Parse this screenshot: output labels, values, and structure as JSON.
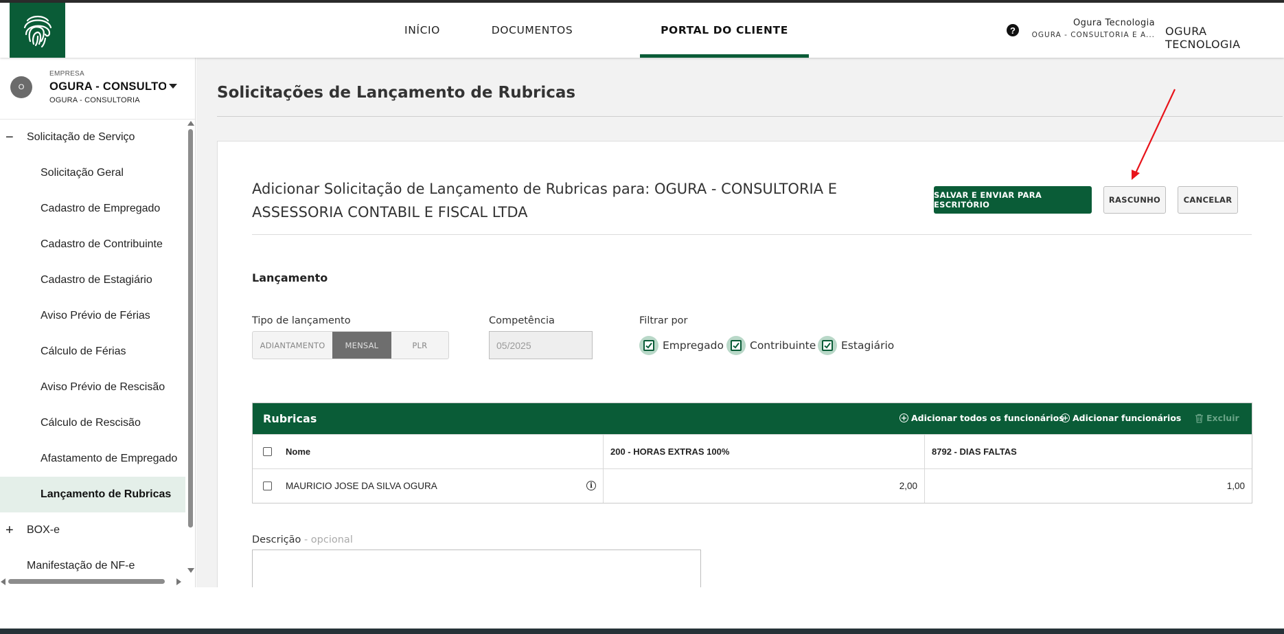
{
  "header": {
    "nav": [
      {
        "label": "INÍCIO",
        "active": false
      },
      {
        "label": "DOCUMENTOS",
        "active": false
      },
      {
        "label": "PORTAL DO CLIENTE",
        "active": true
      }
    ],
    "help_icon": "?",
    "user_name": "Ogura Tecnologia",
    "user_company": "OGURA - CONSULTORIA E A...",
    "org_name": "OGURA TECNOLOGIA",
    "brand_color": "#0a5c37"
  },
  "sidebar": {
    "company_avatar": "O",
    "company_label": "EMPRESA",
    "company_name": "OGURA - CONSULTORIA E ASSESSORIA",
    "company_sub": "OGURA - CONSULTORIA",
    "items": [
      {
        "label": "Solicitação de Serviço",
        "type": "group",
        "sign": "−"
      },
      {
        "label": "Solicitação Geral",
        "type": "sub"
      },
      {
        "label": "Cadastro de Empregado",
        "type": "sub"
      },
      {
        "label": "Cadastro de Contribuinte",
        "type": "sub"
      },
      {
        "label": "Cadastro de Estagiário",
        "type": "sub"
      },
      {
        "label": "Aviso Prévio de Férias",
        "type": "sub"
      },
      {
        "label": "Cálculo de Férias",
        "type": "sub"
      },
      {
        "label": "Aviso Prévio de Rescisão",
        "type": "sub"
      },
      {
        "label": "Cálculo de Rescisão",
        "type": "sub"
      },
      {
        "label": "Afastamento de Empregado",
        "type": "sub"
      },
      {
        "label": "Lançamento de Rubricas",
        "type": "sub",
        "active": true
      },
      {
        "label": "BOX-e",
        "type": "group",
        "sign": "+"
      },
      {
        "label": "Manifestação de NF-e",
        "type": "group"
      }
    ]
  },
  "main": {
    "page_title": "Solicitações de Lançamento de Rubricas",
    "form_title": "Adicionar Solicitação de Lançamento de Rubricas para: OGURA - CONSULTORIA E ASSESSORIA CONTABIL E FISCAL LTDA",
    "buttons": {
      "save_send": "SALVAR E ENVIAR PARA ESCRITÓRIO",
      "draft": "RASCUNHO",
      "cancel": "CANCELAR"
    },
    "section_title": "Lançamento",
    "tipo_label": "Tipo de lançamento",
    "tipo_options": [
      "ADIANTAMENTO",
      "MENSAL",
      "PLR"
    ],
    "tipo_selected": "MENSAL",
    "competencia_label": "Competência",
    "competencia_value": "05/2025",
    "filtrar_label": "Filtrar por",
    "filters": [
      {
        "label": "Empregado",
        "checked": true
      },
      {
        "label": "Contribuinte",
        "checked": true
      },
      {
        "label": "Estagiário",
        "checked": true
      }
    ],
    "table": {
      "title": "Rubricas",
      "actions": {
        "add_all": "Adicionar todos os funcionários",
        "add": "Adicionar funcionários",
        "delete": "Excluir"
      },
      "columns": [
        "Nome",
        "200 - HORAS EXTRAS 100%",
        "8792 - DIAS FALTAS"
      ],
      "rows": [
        {
          "name": "MAURICIO JOSE DA SILVA OGURA",
          "col_a": "2,00",
          "col_b": "1,00"
        }
      ]
    },
    "description_label": "Descrição",
    "description_optional": "- opcional",
    "description_value": ""
  }
}
